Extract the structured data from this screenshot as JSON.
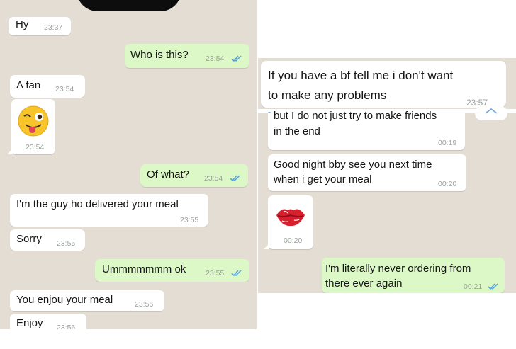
{
  "left_chat": {
    "messages": [
      {
        "text": "Hy",
        "time": "23:37"
      },
      {
        "text": "Who is this?",
        "time": "23:54"
      },
      {
        "text": "A fan",
        "time": "23:54"
      },
      {
        "emoji": "winking-tongue-emoji",
        "time": "23:54"
      },
      {
        "text": "Of what?",
        "time": "23:54"
      },
      {
        "text": "I'm the guy ho delivered your meal",
        "time": "23:55"
      },
      {
        "text": "Sorry",
        "time": "23:55"
      },
      {
        "text": "Ummmmmmm ok",
        "time": "23:55"
      },
      {
        "text": "You enjou your meal",
        "time": "23:56"
      },
      {
        "text": "Enjoy",
        "time": "23:56"
      }
    ]
  },
  "right_chat": {
    "messages": [
      {
        "text_line1": "If you have a bf tell me i don't want",
        "text_line2": "to make any problems",
        "time": "23:57"
      },
      {
        "text_line1": "but I do not just try to make friends",
        "text_line2": "in the end",
        "time": "00:19"
      },
      {
        "text_line1": "Good night bby see you next time",
        "text_line2": "when i get your meal",
        "time": "00:20"
      },
      {
        "emoji": "kiss-lips-emoji",
        "time": "00:20"
      },
      {
        "text_line1": "I'm literally never ordering from",
        "text_line2": "there ever again",
        "time": "00:21"
      }
    ]
  },
  "colors": {
    "chat_background": "#e4ddd4",
    "incoming_bubble": "#ffffff",
    "outgoing_bubble": "#dcf8c6",
    "read_ticks": "#4fa3e0"
  }
}
